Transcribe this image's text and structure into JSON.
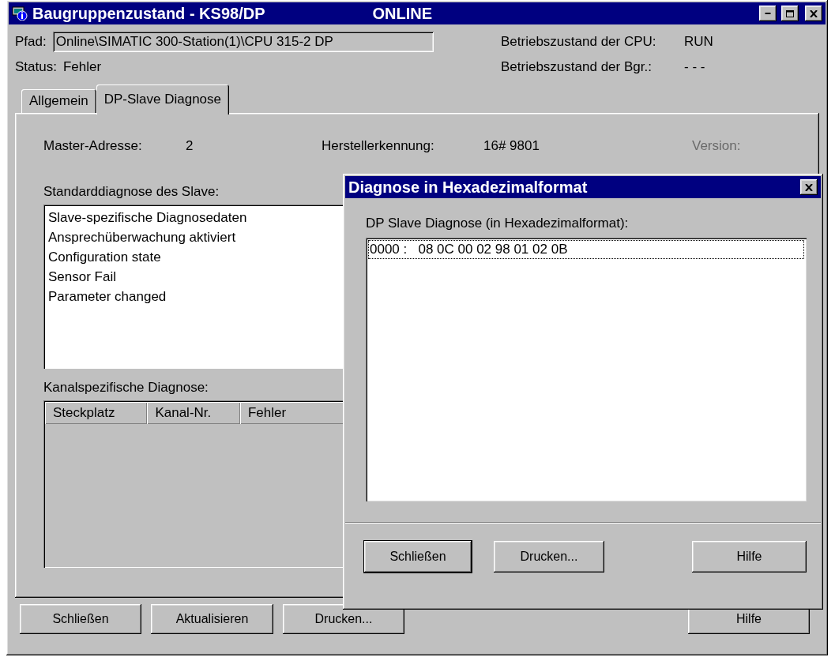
{
  "window": {
    "title": "Baugruppenzustand - KS98/DP",
    "mode": "ONLINE"
  },
  "path": {
    "label": "Pfad:",
    "value": "Online\\SIMATIC 300-Station(1)\\CPU 315-2 DP"
  },
  "status": {
    "label": "Status:",
    "value": "Fehler"
  },
  "cpu_state": {
    "label": "Betriebszustand der CPU:",
    "value": "RUN"
  },
  "module_state": {
    "label": "Betriebszustand der Bgr.:",
    "value": "- - -"
  },
  "tabs": [
    {
      "label": "Allgemein",
      "selected": false
    },
    {
      "label": "DP-Slave Diagnose",
      "selected": true
    }
  ],
  "panel": {
    "master_address": {
      "label": "Master-Adresse:",
      "value": "2"
    },
    "vendor_id": {
      "label": "Herstellerkennung:",
      "value": "16# 9801"
    },
    "version": {
      "label": "Version:",
      "disabled": true
    },
    "standard_diagnosis": {
      "label": "Standarddiagnose des Slave:",
      "items": [
        "Slave-spezifische Diagnosedaten",
        "Ansprechüberwachung aktiviert",
        "Configuration state",
        "Sensor Fail",
        "Parameter changed"
      ]
    },
    "channel_diagnosis": {
      "label": "Kanalspezifische Diagnose:",
      "columns": [
        "Steckplatz",
        "Kanal-Nr.",
        "Fehler"
      ]
    }
  },
  "hex_dialog": {
    "title": "Diagnose in Hexadezimalformat",
    "label": "DP Slave Diagnose (in Hexadezimalformat):",
    "rows": [
      {
        "text": "0000 :   08 0C 00 02 98 01 02 0B",
        "focused": true
      }
    ],
    "buttons": [
      {
        "label": "Schließen",
        "default": true
      },
      {
        "label": "Drucken...",
        "default": false
      },
      {
        "label": "Hilfe",
        "default": false
      }
    ]
  },
  "buttons": [
    {
      "label": "Schließen",
      "default": false
    },
    {
      "label": "Aktualisieren",
      "default": false
    },
    {
      "label": "Drucken...",
      "default": false
    },
    {
      "label": "Hilfe",
      "default": false
    }
  ]
}
